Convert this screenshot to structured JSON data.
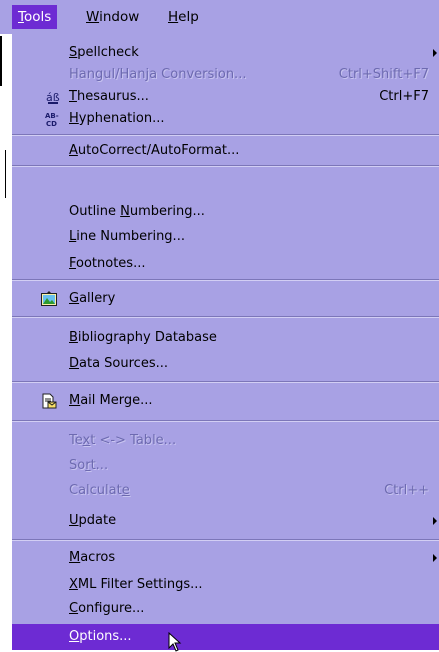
{
  "menubar": {
    "tools": {
      "pre": "",
      "u": "T",
      "post": "ools"
    },
    "window": {
      "pre": "",
      "u": "W",
      "post": "indow"
    },
    "help": {
      "pre": "",
      "u": "H",
      "post": "elp"
    }
  },
  "menu": {
    "spellcheck": {
      "pre": "",
      "u": "S",
      "post": "pellcheck"
    },
    "hangul": {
      "pre": "Hangul/Han",
      "u": "j",
      "post": "a Conversion...",
      "shortcut": "Ctrl+Shift+F7"
    },
    "thesaurus": {
      "pre": "",
      "u": "T",
      "post": "hesaurus...",
      "shortcut": "Ctrl+F7"
    },
    "hyphenation": {
      "pre": "",
      "u": "H",
      "post": "yphenation..."
    },
    "autocorrect": {
      "pre": "",
      "u": "A",
      "post": "utoCorrect/AutoFormat..."
    },
    "outline": {
      "pre": "Outline ",
      "u": "N",
      "post": "umbering..."
    },
    "line_numbering": {
      "pre": "",
      "u": "L",
      "post": "ine Numbering..."
    },
    "footnotes": {
      "pre": "",
      "u": "F",
      "post": "ootnotes..."
    },
    "gallery": {
      "pre": "",
      "u": "G",
      "post": "allery"
    },
    "bibliography": {
      "pre": "",
      "u": "B",
      "post": "ibliography Database"
    },
    "data_sources": {
      "pre": "",
      "u": "D",
      "post": "ata Sources..."
    },
    "mail_merge": {
      "pre": "",
      "u": "M",
      "post": "ail Merge..."
    },
    "text_table": {
      "pre": "Te",
      "u": "x",
      "post": "t <-> Table..."
    },
    "sort": {
      "pre": "So",
      "u": "r",
      "post": "t..."
    },
    "calculate": {
      "pre": "Calculat",
      "u": "e",
      "post": "",
      "shortcut": "Ctrl++"
    },
    "update": {
      "pre": "",
      "u": "U",
      "post": "pdate"
    },
    "macros": {
      "pre": "",
      "u": "M",
      "post": "acros"
    },
    "xml_filter": {
      "pre": "",
      "u": "X",
      "post": "ML Filter Settings..."
    },
    "configure": {
      "pre": "",
      "u": "C",
      "post": "onfigure..."
    },
    "options": {
      "pre": "",
      "u": "O",
      "post": "ptions..."
    }
  },
  "icons": {
    "thesaurus": "thesaurus-icon",
    "hyphenation": "hyphenation-icon",
    "gallery": "gallery-icon",
    "mail_merge": "mail-merge-icon",
    "cursor": "mouse-pointer-icon"
  },
  "colors": {
    "menu_bg": "#a8a1e4",
    "highlight": "#6d2bd3",
    "disabled_text": "#6d6ab0"
  }
}
